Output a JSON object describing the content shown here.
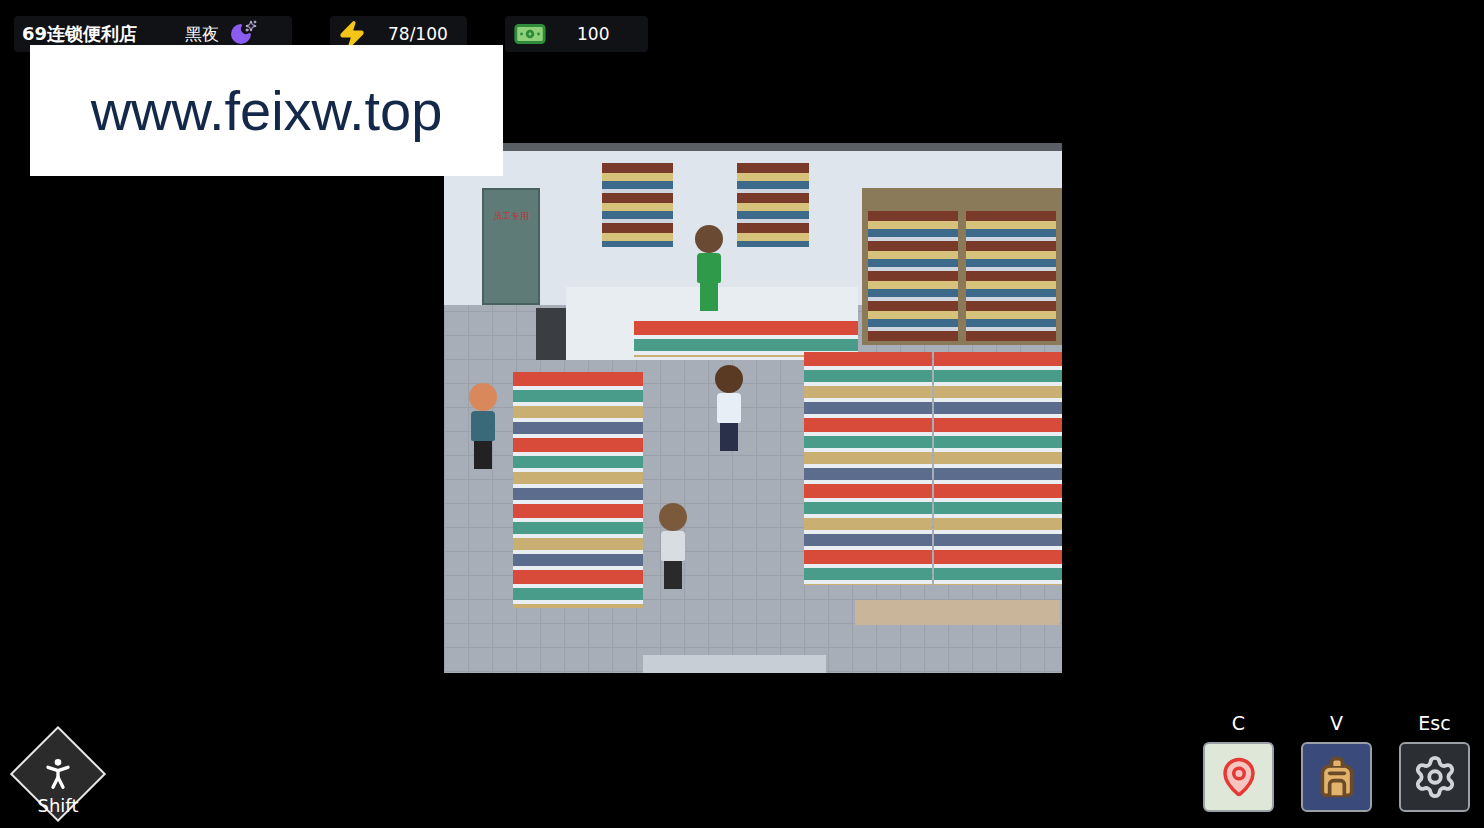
{
  "hud": {
    "location": "69连锁便利店",
    "time_of_day": "黑夜",
    "energy": "78/100",
    "money": "100"
  },
  "watermark": "www.feixw.top",
  "scene": {
    "door_label": "员工专用"
  },
  "run_button": {
    "key": "Shift"
  },
  "menu_buttons": [
    {
      "key": "C",
      "kind": "map"
    },
    {
      "key": "V",
      "kind": "bag"
    },
    {
      "key": "Esc",
      "kind": "settings"
    }
  ]
}
